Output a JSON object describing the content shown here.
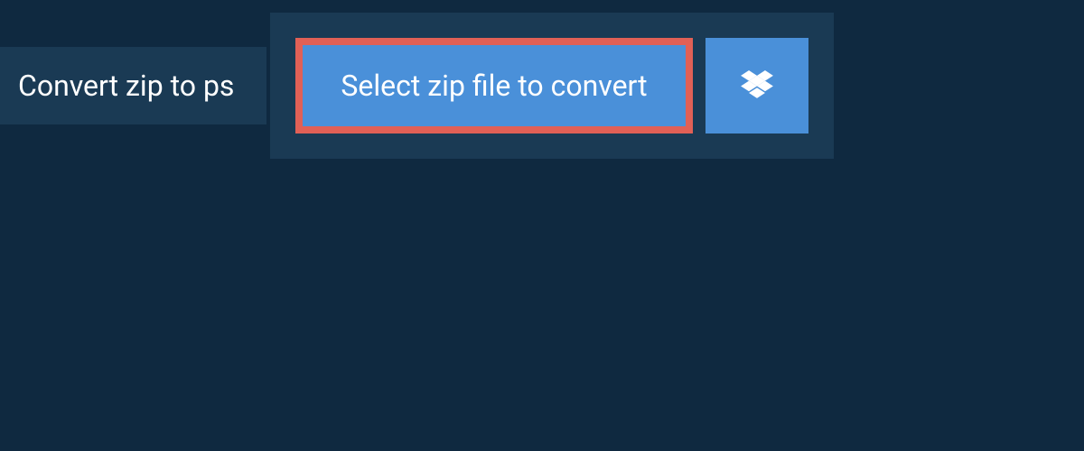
{
  "header": {
    "title": "Convert zip to ps"
  },
  "upload": {
    "select_button_label": "Select zip file to convert",
    "dropbox_icon_name": "dropbox-icon"
  },
  "colors": {
    "page_bg": "#0f2940",
    "panel_bg": "#1a3a54",
    "button_bg": "#4a90d9",
    "highlight_border": "#e16056",
    "text": "#ffffff"
  }
}
